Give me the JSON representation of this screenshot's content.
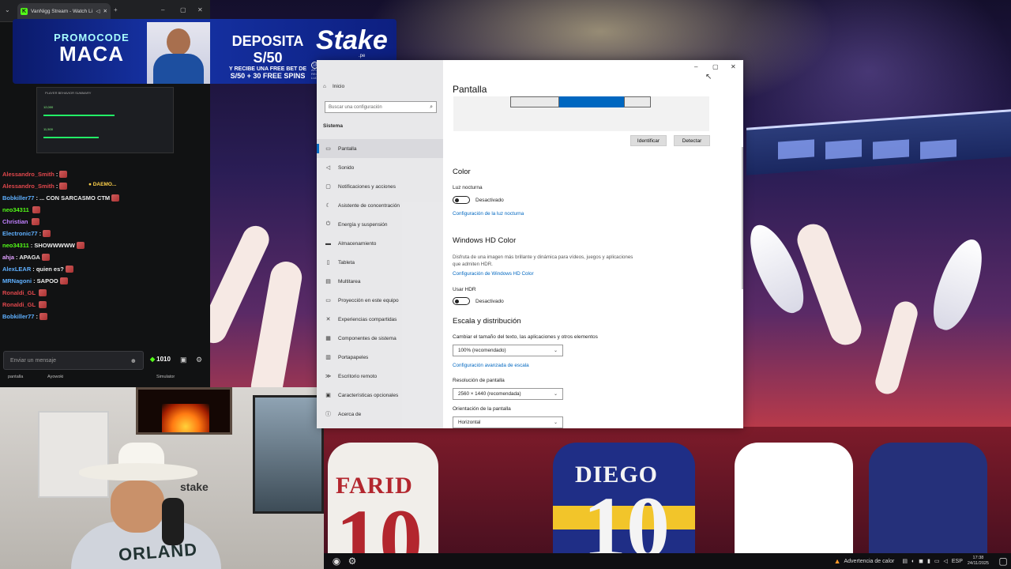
{
  "browser": {
    "tab_title": "VanNigg Stream - Watch Li",
    "tab_favicon": "K"
  },
  "banner": {
    "promo_label": "PROMOCODE",
    "promo_code": "MACA",
    "deposit_line": "DEPOSITA S/50",
    "deposit_sub": "Y RECIBE UNA FREE BET DE",
    "deposit_bonus": "S/50 + 30 FREE SPINS",
    "brand": "Stake",
    "brand_domain": ".pe",
    "age": "18",
    "disclaimer": "SÓLO PARA MAYORES DE 18 AÑOS. LAS APUESTAS DEPORTIVAS A DISTANCIA. INSCRIBIR EN REGISTRO PUEDEN CAUSAR ADICCIÓN Y LUDOPATÍA."
  },
  "behavior_panel": {
    "title": "PLAYER BEHAVIOR SUMMARY",
    "value1": "12,000",
    "value2": "11,500"
  },
  "chat": {
    "lines": [
      {
        "user": "Alessandro_Smith",
        "text": ":",
        "color": "#e0474c"
      },
      {
        "user": "Alessandro_Smith",
        "text": ":",
        "color": "#e0474c"
      },
      {
        "user": "Bobkiller77",
        "text": ": ... CON SARCASMO CTM",
        "color": "#5fb0ff"
      },
      {
        "user": "neo34311",
        "text": "",
        "color": "#53fc18"
      },
      {
        "user": "Christian",
        "text": "",
        "color": "#c080ff"
      },
      {
        "user": "Electronic77",
        "text": ":",
        "color": "#5fb0ff"
      },
      {
        "user": "neo34311",
        "text": ": SHOWWWWW",
        "color": "#53fc18"
      },
      {
        "user": "ahja",
        "text": ": APAGA",
        "color": "#e0a0ff"
      },
      {
        "user": "AlexLEAR",
        "text": ": quien es?",
        "color": "#5fb0ff"
      },
      {
        "user": "MRNagoni",
        "text": ": SAPOO",
        "color": "#5fb0ff"
      },
      {
        "user": "Ronaldi_GL",
        "text": "",
        "color": "#e0474c"
      },
      {
        "user": "Ronaldi_GL",
        "text": "",
        "color": "#e0474c"
      },
      {
        "user": "Bobkiller77",
        "text": ":",
        "color": "#5fb0ff"
      }
    ],
    "daemon_tag": "DAEMO...",
    "input_placeholder": "Enviar un mensaje",
    "points": "1010",
    "footer_left": "pantalla",
    "footer_mid": "Ayowoki",
    "footer_right": "Simulator"
  },
  "webcam": {
    "hoodie_text": "ORLAND",
    "wall_text": "stake"
  },
  "settings": {
    "sidebar": {
      "home": "Inicio",
      "search_placeholder": "Buscar una configuración",
      "group": "Sistema",
      "items": [
        {
          "label": "Pantalla",
          "icon": "monitor-icon",
          "glyph": "▭"
        },
        {
          "label": "Sonido",
          "icon": "speaker-icon",
          "glyph": "◁"
        },
        {
          "label": "Notificaciones y acciones",
          "icon": "notification-icon",
          "glyph": "▢"
        },
        {
          "label": "Asistente de concentración",
          "icon": "moon-icon",
          "glyph": "☾"
        },
        {
          "label": "Energía y suspensión",
          "icon": "power-icon",
          "glyph": "⏻"
        },
        {
          "label": "Almacenamiento",
          "icon": "storage-icon",
          "glyph": "▬"
        },
        {
          "label": "Tableta",
          "icon": "tablet-icon",
          "glyph": "▯"
        },
        {
          "label": "Multitarea",
          "icon": "multitask-icon",
          "glyph": "▤"
        },
        {
          "label": "Proyección en este equipo",
          "icon": "projection-icon",
          "glyph": "▭"
        },
        {
          "label": "Experiencias compartidas",
          "icon": "share-icon",
          "glyph": "✕"
        },
        {
          "label": "Componentes de sistema",
          "icon": "components-icon",
          "glyph": "▦"
        },
        {
          "label": "Portapapeles",
          "icon": "clipboard-icon",
          "glyph": "▥"
        },
        {
          "label": "Escritorio remoto",
          "icon": "remote-icon",
          "glyph": "≫"
        },
        {
          "label": "Características opcionales",
          "icon": "features-icon",
          "glyph": "▣"
        },
        {
          "label": "Acerca de",
          "icon": "info-icon",
          "glyph": "ⓘ"
        }
      ]
    },
    "main": {
      "title": "Pantalla",
      "identify": "Identificar",
      "detect": "Detectar",
      "color_heading": "Color",
      "night_light_label": "Luz nocturna",
      "night_light_state": "Desactivado",
      "night_light_link": "Configuración de la luz nocturna",
      "hdr_heading": "Windows HD Color",
      "hdr_desc": "Disfruta de una imagen más brillante y dinámica para vídeos, juegos y aplicaciones que admiten HDR.",
      "hdr_link": "Configuración de Windows HD Color",
      "use_hdr_label": "Usar HDR",
      "use_hdr_state": "Desactivado",
      "scale_heading": "Escala y distribución",
      "scale_label": "Cambiar el tamaño del texto, las aplicaciones y otros elementos",
      "scale_value": "100% (recomendado)",
      "scale_link": "Configuración avanzada de escala",
      "resolution_label": "Resolución de pantalla",
      "resolution_value": "2560 × 1440 (recomendada)",
      "orientation_label": "Orientación de la pantalla",
      "orientation_value": "Horizontal"
    }
  },
  "wallpaper": {
    "shirt_left_name": "FARID",
    "shirt_left_number": "10",
    "shirt_mid_name": "DIEGO",
    "shirt_mid_number": "10"
  },
  "taskbar": {
    "warning": "Advertencia de calor",
    "lang": "ESP",
    "time": "17:38",
    "date": "24/11/2025"
  },
  "colors": {
    "accent": "#0067c0",
    "kick_green": "#53fc18"
  }
}
